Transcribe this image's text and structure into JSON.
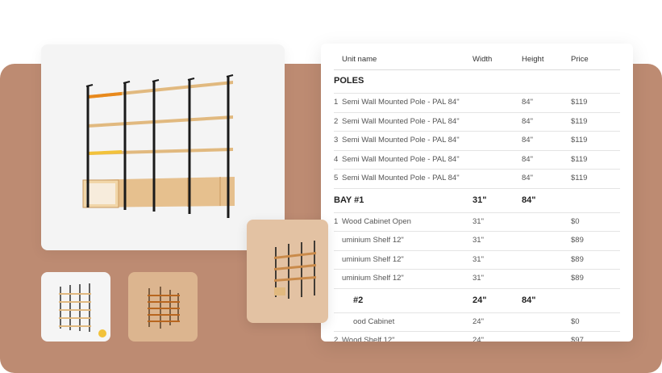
{
  "colors": {
    "background_panel": "#bd8b72",
    "wood": "#e1b97f",
    "pole": "#1a1a1a",
    "accent_orange": "#e8891c",
    "accent_yellow": "#f2c23a"
  },
  "gallery": {
    "main_image": "wall-shelving-unit-photo",
    "thumbnails": [
      "shelving-thumb-white",
      "shelving-thumb-wood",
      "shelving-thumb-angled"
    ]
  },
  "table": {
    "headers": {
      "name": "Unit name",
      "width": "Width",
      "height": "Height",
      "price": "Price"
    },
    "sections": [
      {
        "title": "POLES",
        "width": "",
        "height": "",
        "rows": [
          {
            "idx": "1",
            "name": "Semi Wall Mounted Pole - PAL 84\"",
            "width": "",
            "height": "84\"",
            "price": "$119"
          },
          {
            "idx": "2",
            "name": "Semi Wall Mounted Pole - PAL 84\"",
            "width": "",
            "height": "84\"",
            "price": "$119"
          },
          {
            "idx": "3",
            "name": "Semi Wall Mounted Pole - PAL 84\"",
            "width": "",
            "height": "84\"",
            "price": "$119"
          },
          {
            "idx": "4",
            "name": "Semi Wall Mounted Pole - PAL 84\"",
            "width": "",
            "height": "84\"",
            "price": "$119"
          },
          {
            "idx": "5",
            "name": "Semi Wall Mounted Pole - PAL 84\"",
            "width": "",
            "height": "84\"",
            "price": "$119"
          }
        ]
      },
      {
        "title": "BAY #1",
        "width": "31\"",
        "height": "84\"",
        "rows": [
          {
            "idx": "1",
            "name": "Wood Cabinet Open",
            "width": "31\"",
            "height": "",
            "price": "$0"
          },
          {
            "idx": "",
            "name": "uminium Shelf 12\"",
            "width": "31\"",
            "height": "",
            "price": "$89"
          },
          {
            "idx": "",
            "name": "uminium Shelf 12\"",
            "width": "31\"",
            "height": "",
            "price": "$89"
          },
          {
            "idx": "",
            "name": "uminium Shelf 12\"",
            "width": "31\"",
            "height": "",
            "price": "$89"
          }
        ]
      },
      {
        "title": "#2",
        "width": "24\"",
        "height": "84\"",
        "rows": [
          {
            "idx": "",
            "name": "ood Cabinet",
            "width": "24\"",
            "height": "",
            "price": "$0"
          },
          {
            "idx": "2",
            "name": "Wood Shelf 12\"",
            "width": "24\"",
            "height": "",
            "price": "$97"
          }
        ]
      }
    ]
  }
}
